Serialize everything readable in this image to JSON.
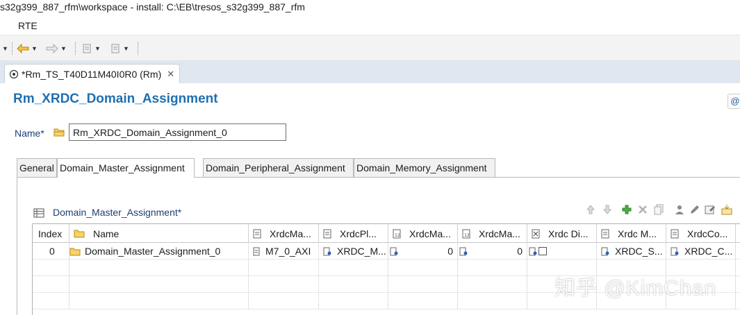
{
  "window": {
    "title": "s32g399_887_rfm\\workspace - install: C:\\EB\\tresos_s32g399_887_rfm"
  },
  "menubar": {
    "items": [
      "RTE"
    ]
  },
  "editor_tab": {
    "label": "*Rm_TS_T40D11M40I0R0 (Rm)"
  },
  "page": {
    "heading": "Rm_XRDC_Domain_Assignment",
    "name_label": "Name*",
    "name_value": "Rm_XRDC_Domain_Assignment_0"
  },
  "tabs": [
    "General",
    "Domain_Master_Assignment",
    "Domain_Peripheral_Assignment",
    "Domain_Memory_Assignment"
  ],
  "active_tab": "Domain_Master_Assignment",
  "section": {
    "title": "Domain_Master_Assignment*"
  },
  "table": {
    "columns": [
      "Index",
      "Name",
      "XrdcMa...",
      "XrdcPl...",
      "XrdcMa...",
      "XrdcMa...",
      "Xrdc Di...",
      "Xrdc M...",
      "XrdcCo..."
    ],
    "rows": [
      {
        "index": "0",
        "name": "Domain_Master_Assignment_0",
        "c1": "M7_0_AXI",
        "c2": "XRDC_M...",
        "c3": "0",
        "c4": "0",
        "c5": "",
        "c6": "XRDC_S...",
        "c7": "XRDC_C..."
      }
    ]
  },
  "watermark": "知乎 @KimChan",
  "colors": {
    "heading": "#1f6fb0",
    "label": "#1d3e73",
    "tabbar": "#dfe7f0",
    "toolbar": "#f3f3f3"
  },
  "icons": [
    "back-arrow-icon",
    "forward-arrow-icon",
    "folder-icon",
    "table-icon",
    "move-up-icon",
    "move-down-icon",
    "add-icon",
    "delete-icon",
    "copy-icon",
    "edit-icon"
  ]
}
